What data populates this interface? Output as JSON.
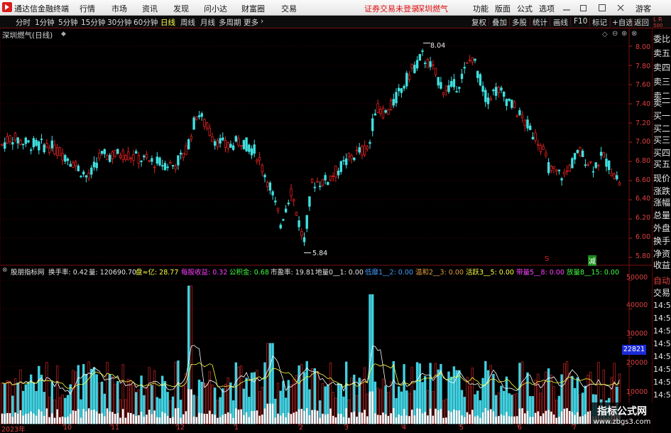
{
  "titlebar": {
    "app_name": "通达信金融终端",
    "menus": [
      "行情",
      "市场",
      "资讯",
      "发现",
      "问小达",
      "财富圈",
      "交易"
    ],
    "status": "证券交易未登录",
    "stock": "深圳燃气",
    "right_menus": [
      "功能",
      "版面",
      "公式",
      "选项"
    ],
    "user": "游客"
  },
  "toolbar": {
    "periods": [
      "分时",
      "1分钟",
      "5分钟",
      "15分钟",
      "30分钟",
      "60分钟",
      "日线",
      "周线",
      "月线",
      "多周期",
      "更多"
    ],
    "active_period": "日线",
    "buttons": [
      "复权",
      "叠加",
      "多股",
      "统计",
      "画线",
      "F10",
      "标记",
      "+自选",
      "返回"
    ]
  },
  "chart": {
    "title": "深圳燃气(日线)",
    "price_high": "8.04",
    "price_low": "5.84",
    "y_ticks": [
      "8.00",
      "7.80",
      "7.60",
      "7.40",
      "7.20",
      "7.00",
      "6.80",
      "6.60",
      "6.40",
      "6.20",
      "6.00",
      "5.80"
    ],
    "markers": {
      "sell": "S",
      "reduce": "减"
    }
  },
  "indicator": {
    "name": "股朋指标网",
    "items": [
      {
        "label": "换手率: 0.42",
        "color": "#e6e6e6"
      },
      {
        "label": "量: 120690.70",
        "color": "#e6e6e6"
      },
      {
        "label": "盘≈亿: 28.77",
        "color": "#ffff40"
      },
      {
        "label": "每股收益: 0.32",
        "color": "#ff40ff"
      },
      {
        "label": "公积金: 0.68",
        "color": "#40ff40"
      },
      {
        "label": "市盈率: 19.81",
        "color": "#e6e6e6"
      },
      {
        "label": "地量0__1: 0.00",
        "color": "#e6e6e6"
      },
      {
        "label": "低靡1__2: 0.00",
        "color": "#40a0ff"
      },
      {
        "label": "温和2__3: 0.00",
        "color": "#e0a040"
      },
      {
        "label": "活跃3__5: 0.00",
        "color": "#ffff40"
      },
      {
        "label": "带量5__8: 0.00",
        "color": "#ff40ff"
      },
      {
        "label": "放量8__15: 0.00",
        "color": "#40ff40"
      }
    ],
    "vol_y_ticks": [
      "50000",
      "40000",
      "30000",
      "20000",
      "10000"
    ],
    "current_vol": "22821"
  },
  "x_labels": [
    "2023年",
    "10",
    "11",
    "12",
    "1",
    "2",
    "3",
    "4",
    "5",
    "6",
    "7"
  ],
  "sidebar": {
    "header": "L R",
    "items": [
      "委比",
      "卖五",
      "卖四",
      "卖三",
      "卖二",
      "卖一",
      "买一",
      "买二",
      "买三",
      "买四",
      "买五",
      "现价",
      "涨跌",
      "涨幅",
      "总量",
      "外盘",
      "换手",
      "净资",
      "收益"
    ],
    "lower": [
      "自动",
      "交易",
      "14:56",
      "14:56",
      "14:56",
      "14:56",
      "14:56",
      "14:56",
      "14:56",
      "14:56"
    ]
  },
  "watermark": {
    "title": "指标公式网",
    "url": "www.zbgs3.com"
  },
  "colors": {
    "up": "#e02020",
    "down": "#40e0e0",
    "grid": "#5a0000"
  }
}
